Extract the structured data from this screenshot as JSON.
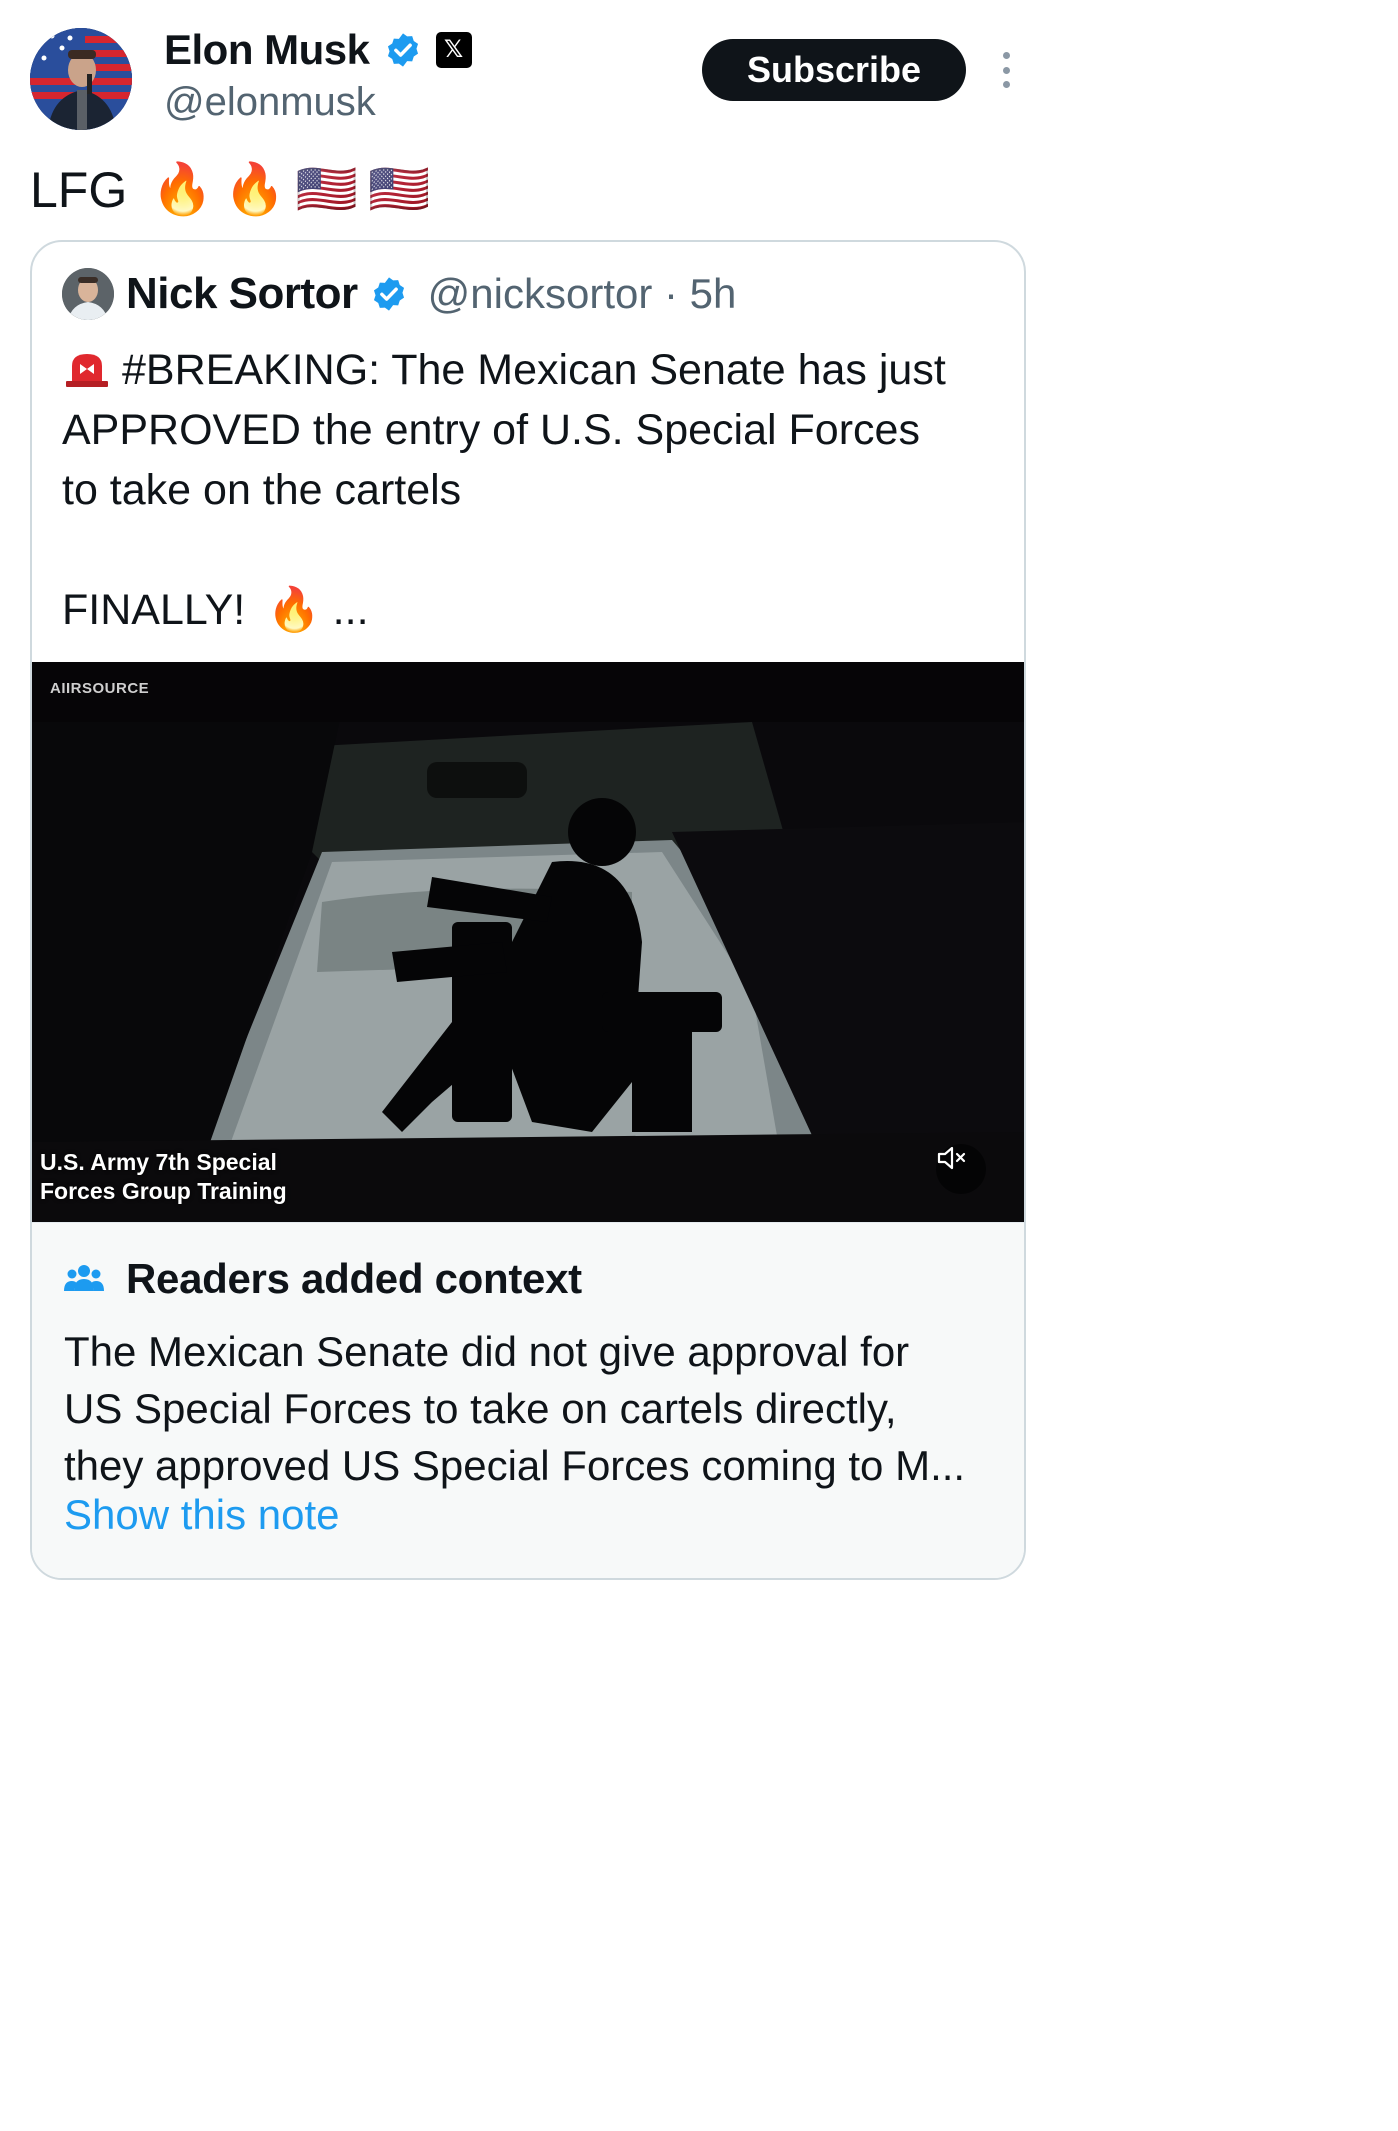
{
  "author": {
    "name": "Elon Musk",
    "handle": "@elonmusk",
    "verified_color": "#1d9bf0",
    "affiliate_badge": "x-logo-icon"
  },
  "actions": {
    "subscribe_label": "Subscribe",
    "more_icon": "more-vertical-icon"
  },
  "post": {
    "text": "LFG",
    "emojis": [
      "🔥",
      "🔥",
      "🇺🇸",
      "🇺🇸"
    ]
  },
  "quoted": {
    "name": "Nick Sortor",
    "handle": "@nicksortor · 5h",
    "siren_icon": "rotating-light-icon",
    "body_lines": [
      "#BREAKING: The Mexican Senate has just",
      "APPROVED the entry of U.S. Special Forces",
      "to take on the cartels"
    ],
    "finally": "FINALLY!",
    "finally_emoji": "🔥",
    "ellipsis": "...",
    "video": {
      "source_label": "AIIRSOURCE",
      "caption_lines": [
        "U.S. Army 7th Special",
        "Forces Group Training"
      ],
      "mute_icon": "volume-muted-icon"
    }
  },
  "community_note": {
    "icon": "people-icon",
    "title": "Readers added context",
    "body_lines": [
      "The Mexican Senate did not give approval for",
      "US Special Forces to take on cartels directly,",
      "they approved US Special Forces coming to M..."
    ],
    "link": "Show this note",
    "link_color": "#1d9bf0"
  }
}
